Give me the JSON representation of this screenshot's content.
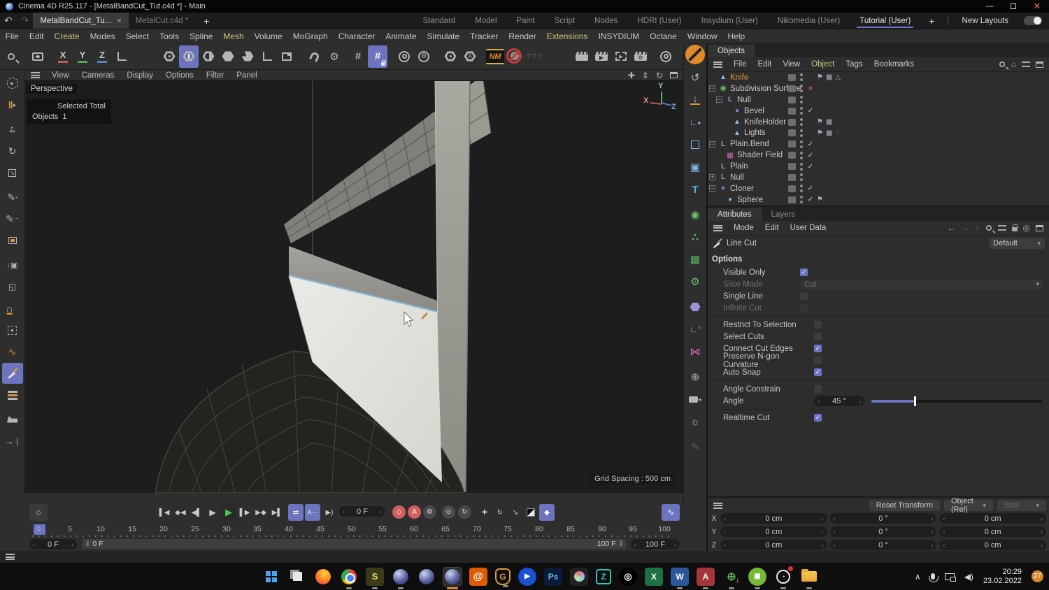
{
  "window": {
    "title": "Cinema 4D R25.117 - [MetalBandCut_Tut.c4d *] - Main"
  },
  "doc_tabs": {
    "tabs": [
      {
        "label": "MetalBandCut_Tu...",
        "close": "×"
      },
      {
        "label": "MetalCut.c4d *"
      }
    ],
    "add": "+"
  },
  "layout_tabs": {
    "items": [
      "Standard",
      "Model",
      "Paint",
      "Script",
      "Nodes",
      "HDRI (User)",
      "Insydium (User)",
      "Nikomedia (User)",
      "Tutorial (User)"
    ],
    "add": "+",
    "new_layouts": "New Layouts"
  },
  "menubar": {
    "items": [
      "File",
      "Edit",
      "Create",
      "Modes",
      "Select",
      "Tools",
      "Spline",
      "Mesh",
      "Volume",
      "MoGraph",
      "Character",
      "Animate",
      "Simulate",
      "Tracker",
      "Render",
      "Extensions",
      "INSYDIUM",
      "Octane",
      "Window",
      "Help"
    ]
  },
  "toolbar": {
    "axis_x": "X",
    "axis_y": "Y",
    "axis_z": "Z",
    "nm_logo": "NM",
    "unknown": "???"
  },
  "viewport": {
    "menu": [
      "View",
      "Cameras",
      "Display",
      "Options",
      "Filter",
      "Panel"
    ],
    "camera_label": "Perspective",
    "hud_selected": "Selected Total",
    "hud_objects_label": "Objects",
    "hud_objects_value": "1",
    "grid_spacing": "Grid Spacing : 500 cm",
    "axis_x": "X",
    "axis_y": "Y",
    "axis_z": "Z"
  },
  "right_tools": {
    "text_tool": "T"
  },
  "objects_panel": {
    "tab": "Objects",
    "menu": [
      "File",
      "Edit",
      "View",
      "Object",
      "Tags",
      "Bookmarks"
    ],
    "tree": [
      {
        "name": "Knife"
      },
      {
        "name": "Subdivision Surface"
      },
      {
        "name": "Null"
      },
      {
        "name": "Bevel"
      },
      {
        "name": "KnifeHolder"
      },
      {
        "name": "Lights"
      },
      {
        "name": "Plain.Bend"
      },
      {
        "name": "Shader Field"
      },
      {
        "name": "Plain"
      },
      {
        "name": "Null"
      },
      {
        "name": "Cloner"
      },
      {
        "name": "Sphere"
      }
    ]
  },
  "attributes_panel": {
    "tabs": [
      "Attributes",
      "Layers"
    ],
    "menu": [
      "Mode",
      "Edit",
      "User Data"
    ],
    "tool_name": "Line Cut",
    "preset": "Default",
    "section": "Options",
    "options": [
      {
        "label": "Visible Only",
        "checked": true
      },
      {
        "label": "Slice Mode",
        "value": "Cut",
        "disabled": true
      },
      {
        "label": "Single Line",
        "checked": false
      },
      {
        "label": "Infinite Cut",
        "checked": false,
        "disabled": true
      },
      {
        "label": "Restrict To Selection",
        "checked": false
      },
      {
        "label": "Select Cuts",
        "checked": false
      },
      {
        "label": "Connect Cut Edges",
        "checked": true
      },
      {
        "label": "Preserve N-gon Curvature",
        "checked": false
      },
      {
        "label": "Auto Snap",
        "checked": true
      },
      {
        "label": "Angle Constrain",
        "checked": false
      },
      {
        "label": "Angle",
        "value": "45 °"
      },
      {
        "label": "Realtime Cut",
        "checked": true
      }
    ]
  },
  "coordinates": {
    "reset": "Reset Transform",
    "mode": "Object (Rel)",
    "size": "Size",
    "axes": [
      {
        "axis": "X",
        "pos": "0 cm",
        "rot": "0 °",
        "scale": "0 cm"
      },
      {
        "axis": "Y",
        "pos": "0 cm",
        "rot": "0 °",
        "scale": "0 cm"
      },
      {
        "axis": "Z",
        "pos": "0 cm",
        "rot": "0 °",
        "scale": "0 cm"
      }
    ]
  },
  "timeline": {
    "current": "0 F",
    "ticks": [
      "0",
      "5",
      "10",
      "15",
      "20",
      "25",
      "30",
      "35",
      "40",
      "45",
      "50",
      "55",
      "60",
      "65",
      "70",
      "75",
      "80",
      "85",
      "90",
      "95",
      "100"
    ],
    "range_start": "0 F",
    "range_start_handle": "0 F",
    "range_end_handle": "100 F",
    "range_end": "100 F"
  },
  "taskbar": {
    "letters": {
      "sublime": "S",
      "gshield": "G",
      "photoshop": "Ps",
      "fz": "Z",
      "excel": "X",
      "word": "W",
      "access": "A"
    },
    "time": "20:29",
    "date": "23.02.2022",
    "badge": "27"
  }
}
